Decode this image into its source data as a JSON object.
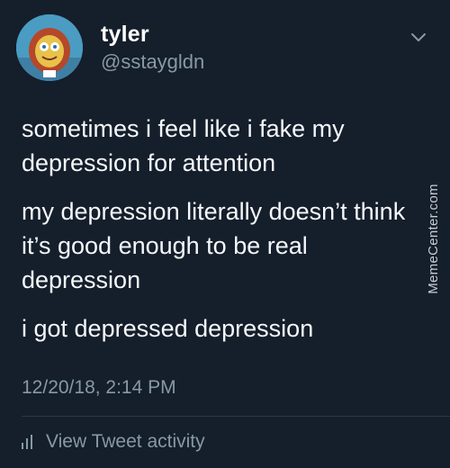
{
  "user": {
    "display_name": "tyler",
    "handle": "@sstaygldn",
    "avatar_icon": "spongebob-avatar"
  },
  "tweet": {
    "paragraphs": [
      "sometimes i feel like i fake my depression for attention",
      "my depression literally doesn’t think it’s good enough to be real depression",
      "i got depressed depression"
    ],
    "timestamp": "12/20/18, 2:14 PM"
  },
  "actions": {
    "menu_icon": "chevron-down-icon",
    "activity_icon": "bar-chart-icon",
    "activity_label": "View Tweet activity"
  },
  "watermark": {
    "text": "MemeCenter.com"
  },
  "colors": {
    "background": "#151e2b",
    "primary_text": "#f5f8fa",
    "secondary_text": "#8899a6",
    "divider": "#2c3845"
  }
}
